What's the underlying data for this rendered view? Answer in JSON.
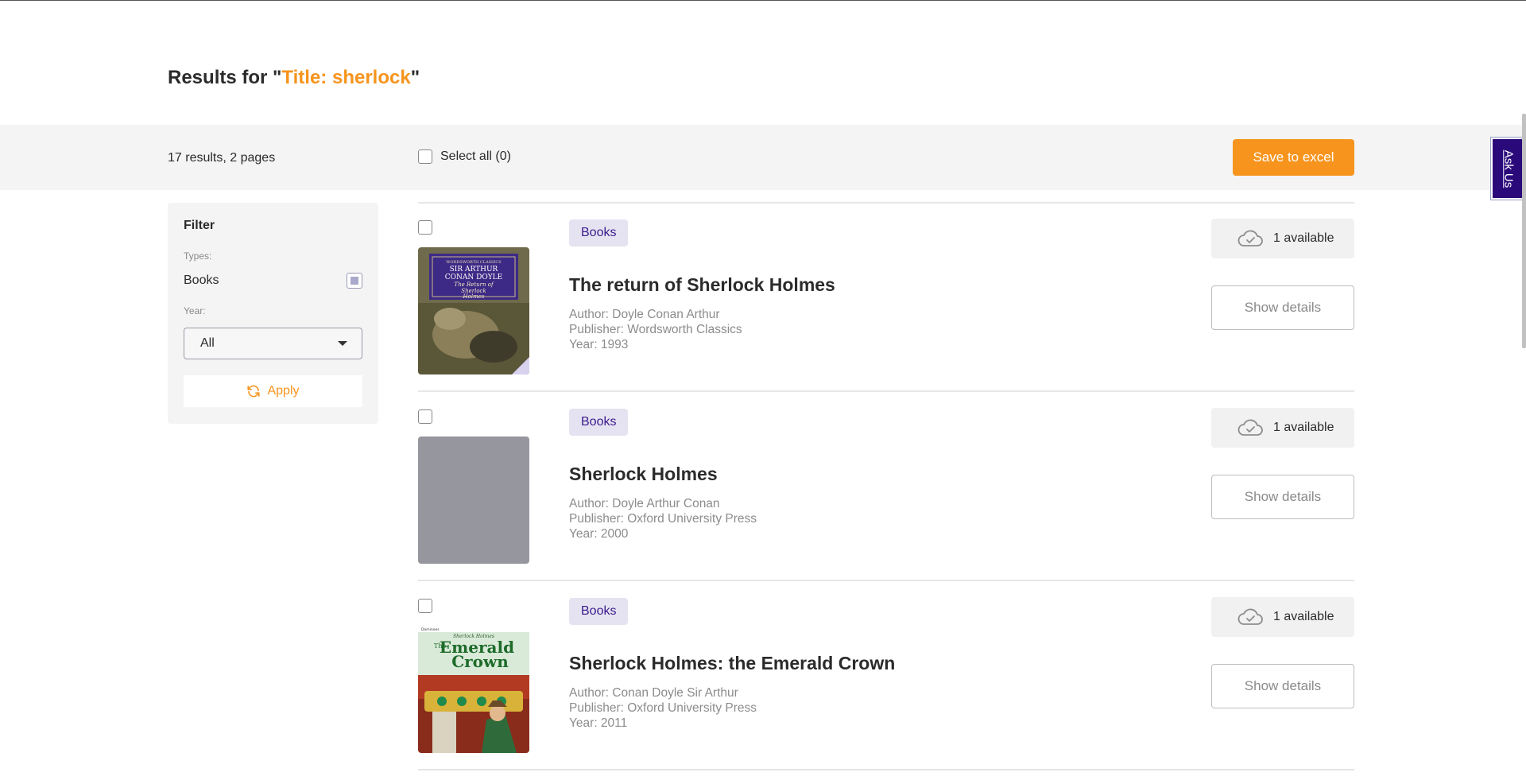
{
  "results": {
    "prefix": "Results for \"",
    "query": "Title: sherlock",
    "suffix": "\""
  },
  "toolbar": {
    "count": "17 results,  2 pages",
    "select_all": "Select all (0)",
    "save_button": "Save to excel"
  },
  "ask_us": "Ask Us",
  "filter": {
    "title": "Filter",
    "types_label": "Types:",
    "type_option": "Books",
    "type_checked": true,
    "year_label": "Year:",
    "year_value": "All",
    "apply_label": "Apply"
  },
  "items": [
    {
      "badge": "Books",
      "title": "The return of Sherlock Holmes",
      "author": "Author: Doyle Conan Arthur",
      "publisher": "Publisher: Wordsworth Classics",
      "year": "Year: 1993",
      "availability": "1 available",
      "details_label": "Show details",
      "cover": "The Return of Sherlock Holmes cover",
      "cover_text": {
        "series": "WORDSWORTH CLASSICS",
        "author1": "SIR ARTHUR",
        "author2": "CONAN DOYLE",
        "title1": "The Return of",
        "title2": "Sherlock",
        "title3": "Holmes"
      }
    },
    {
      "badge": "Books",
      "title": "Sherlock Holmes",
      "author": "Author: Doyle Arthur Conan",
      "publisher": "Publisher: Oxford University Press",
      "year": "Year: 2000",
      "availability": "1 available",
      "details_label": "Show details",
      "cover": "placeholder"
    },
    {
      "badge": "Books",
      "title": "Sherlock Holmes: the Emerald Crown",
      "author": "Author: Conan Doyle Sir Arthur",
      "publisher": "Publisher: Oxford University Press",
      "year": "Year: 2011",
      "availability": "1 available",
      "details_label": "Show details",
      "cover": "The Emerald Crown cover",
      "cover_text": {
        "brand": "Dominoes",
        "series": "Sherlock Holmes",
        "title1": "The",
        "title2": "Emerald",
        "title3": "Crown"
      }
    }
  ],
  "colors": {
    "accent": "#f7941d",
    "badge_text": "#3b1a8c",
    "ask_us_bg": "#2a0a7a"
  },
  "icons": {
    "availability": "cloud-check-icon",
    "apply": "refresh-icon",
    "dropdown": "caret-down-icon"
  }
}
